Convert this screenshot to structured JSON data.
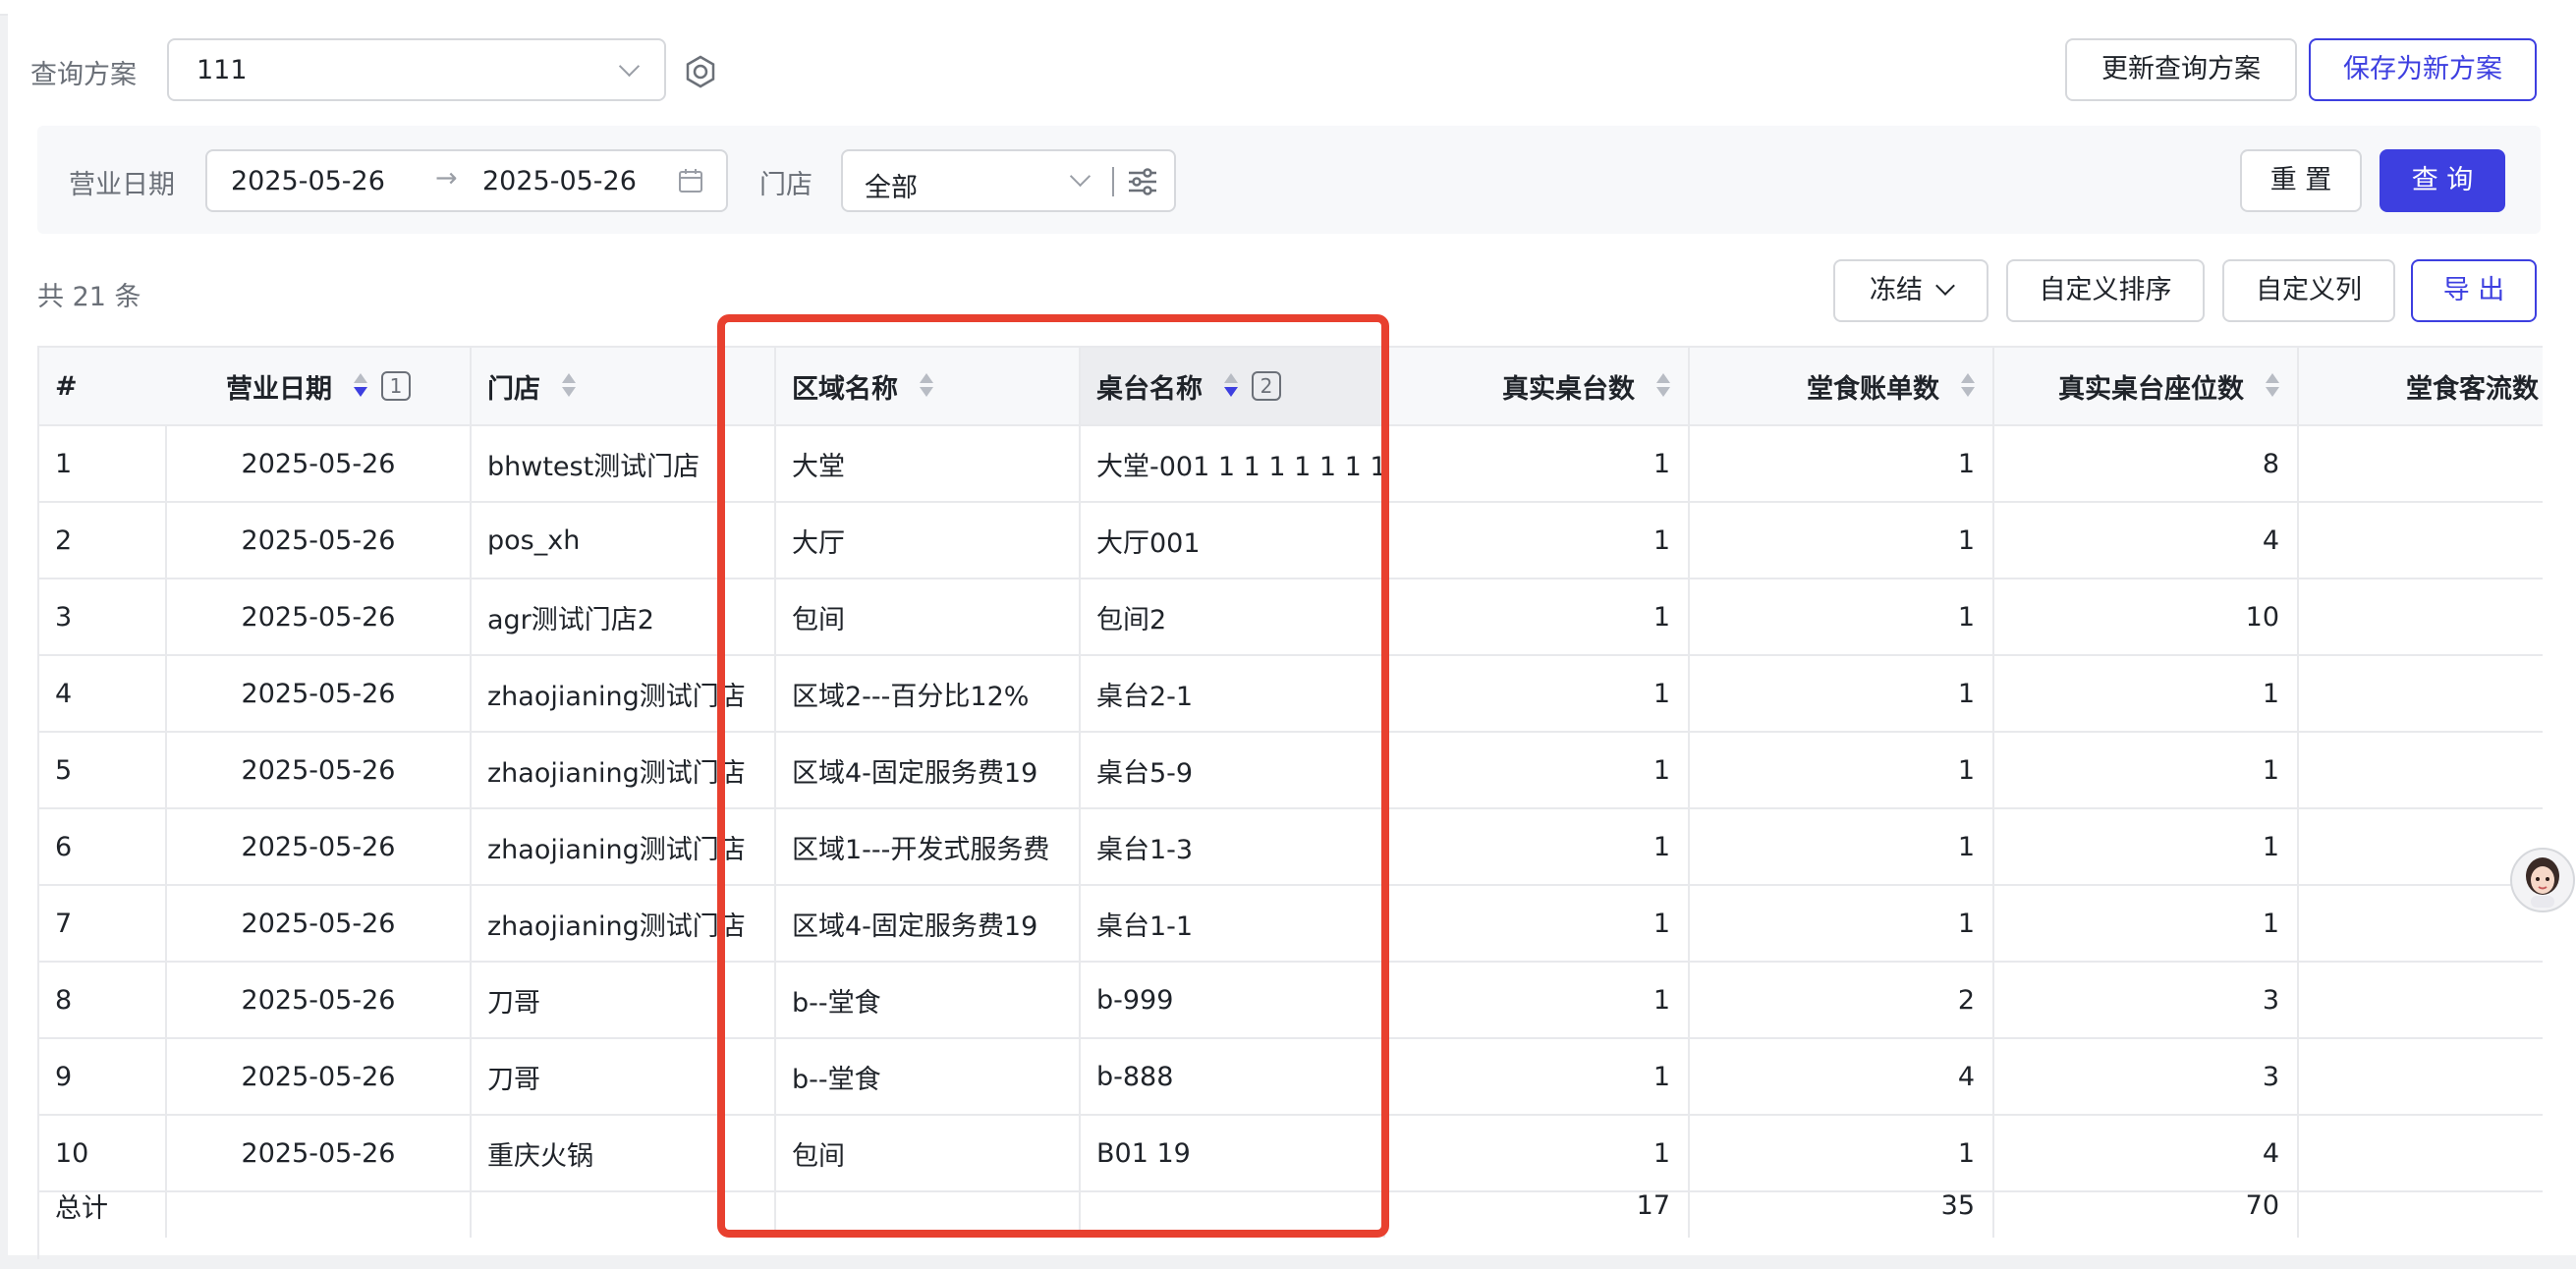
{
  "query_scheme": {
    "label": "查询方案",
    "selected": "111",
    "update_button": "更新查询方案",
    "save_new_button": "保存为新方案"
  },
  "filters": {
    "date_label": "营业日期",
    "start_date": "2025-05-26",
    "range_arrow": "→",
    "end_date": "2025-05-26",
    "store_label": "门店",
    "store_value": "全部",
    "reset_button": "重 置",
    "query_button": "查 询"
  },
  "toolbar": {
    "total_text": "共 21 条",
    "freeze_button": "冻结",
    "custom_sort_button": "自定义排序",
    "custom_columns_button": "自定义列",
    "export_button": "导 出"
  },
  "table": {
    "columns": [
      {
        "label": "#"
      },
      {
        "label": "营业日期",
        "sort_index": "1"
      },
      {
        "label": "门店"
      },
      {
        "label": "区域名称"
      },
      {
        "label": "桌台名称",
        "sort_index": "2"
      },
      {
        "label": "真实桌台数"
      },
      {
        "label": "堂食账单数"
      },
      {
        "label": "真实桌台座位数"
      },
      {
        "label": "堂食客流数"
      }
    ],
    "rows": [
      [
        "1",
        "2025-05-26",
        "bhwtest测试门店",
        "大堂",
        "大堂-001 1 1 1 1 1 1 1",
        "1",
        "1",
        "8"
      ],
      [
        "2",
        "2025-05-26",
        "pos_xh",
        "大厅",
        "大厅001",
        "1",
        "1",
        "4"
      ],
      [
        "3",
        "2025-05-26",
        "agr测试门店2",
        "包间",
        "包间2",
        "1",
        "1",
        "10"
      ],
      [
        "4",
        "2025-05-26",
        "zhaojianing测试门店",
        "区域2---百分比12%",
        "桌台2-1",
        "1",
        "1",
        "1"
      ],
      [
        "5",
        "2025-05-26",
        "zhaojianing测试门店",
        "区域4-固定服务费19",
        "桌台5-9",
        "1",
        "1",
        "1"
      ],
      [
        "6",
        "2025-05-26",
        "zhaojianing测试门店",
        "区域1---开发式服务费",
        "桌台1-3",
        "1",
        "1",
        "1"
      ],
      [
        "7",
        "2025-05-26",
        "zhaojianing测试门店",
        "区域4-固定服务费19",
        "桌台1-1",
        "1",
        "1",
        "1"
      ],
      [
        "8",
        "2025-05-26",
        "刀哥",
        "b--堂食",
        "b-999",
        "1",
        "2",
        "3"
      ],
      [
        "9",
        "2025-05-26",
        "刀哥",
        "b--堂食",
        "b-888",
        "1",
        "4",
        "3"
      ],
      [
        "10",
        "2025-05-26",
        "重庆火锅",
        "包间",
        "B01 19",
        "1",
        "1",
        "4"
      ]
    ],
    "total_row": {
      "label": "总计",
      "tables": "17",
      "bills": "35",
      "seats": "70"
    }
  },
  "colors": {
    "accent": "#3d3fe0",
    "highlight_box": "#e8402f"
  }
}
